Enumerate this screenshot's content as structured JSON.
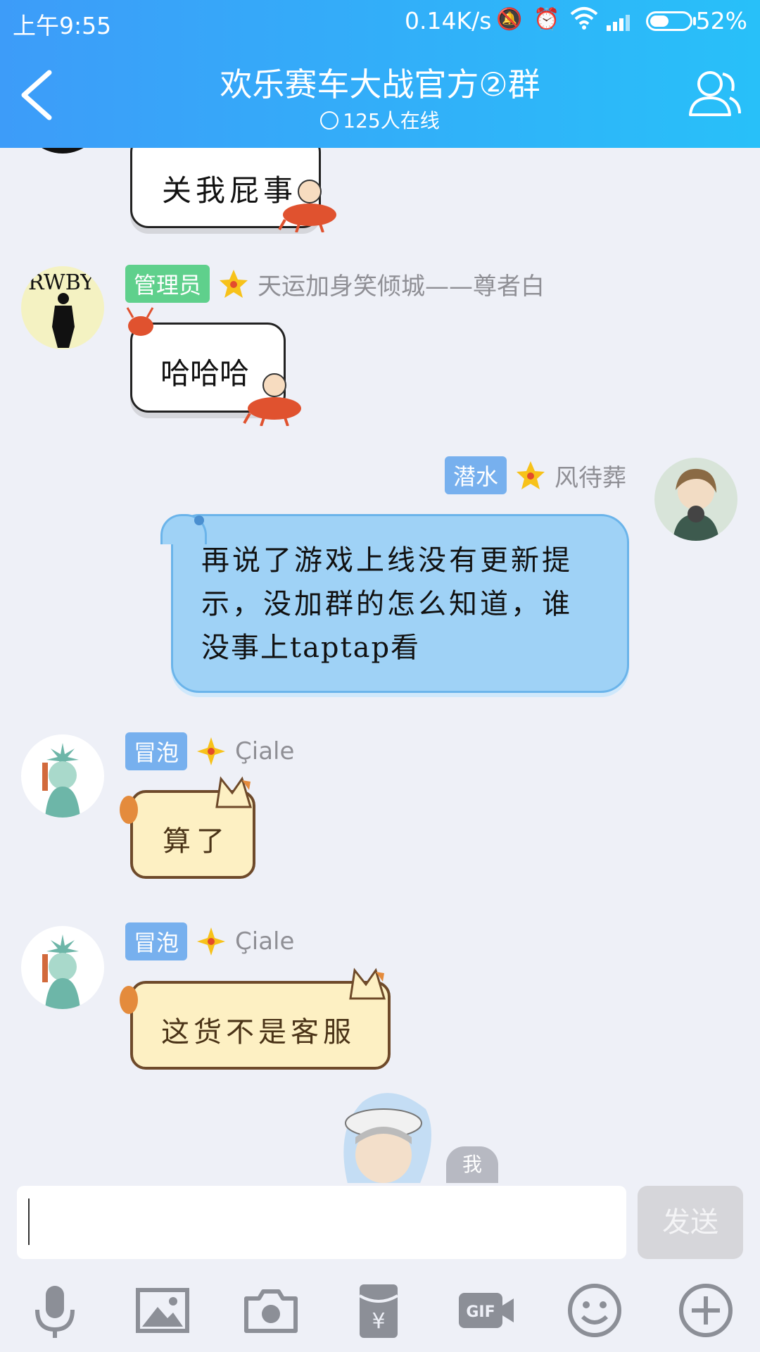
{
  "status_bar": {
    "time": "上午9:55",
    "net_speed": "0.14K/s",
    "battery_pct": "52%",
    "battery_level": 0.52
  },
  "header": {
    "title": "欢乐赛车大战官方②群",
    "online": "125人在线"
  },
  "messages": [
    {
      "text": "关我屁事"
    },
    {
      "badge": "管理员",
      "name": "天运加身笑倾城——尊者白",
      "avatar_text": "RWBY",
      "text": "哈哈哈"
    },
    {
      "badge": "潜水",
      "name": "风待葬",
      "lines": [
        "再说了游戏上线没有更新提",
        "示，没加群的怎么知道，谁",
        "没事上taptap看"
      ]
    },
    {
      "badge": "冒泡",
      "name": "Çiale",
      "text": "算了"
    },
    {
      "badge": "冒泡",
      "name": "Çiale",
      "text": "这货不是客服"
    }
  ],
  "self_label": "我",
  "input": {
    "value": "",
    "send_label": "发送"
  },
  "toolbar_icons": [
    "mic-icon",
    "image-icon",
    "camera-icon",
    "red-packet-icon",
    "gif-icon",
    "emoji-icon",
    "plus-icon"
  ],
  "colors": {
    "header_start": "#3d9cf9",
    "header_end": "#28c0f9",
    "badge_admin": "#5fd08c",
    "badge_member": "#77b0ee"
  }
}
